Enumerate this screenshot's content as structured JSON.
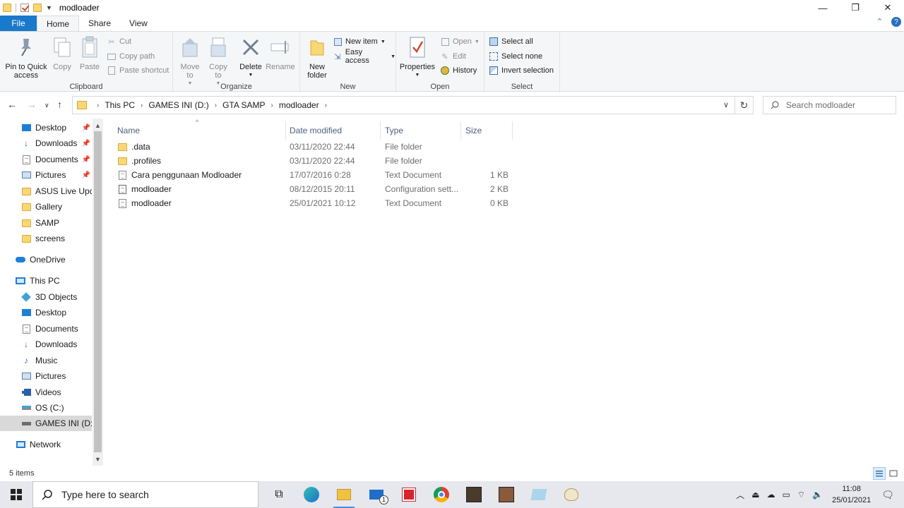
{
  "window": {
    "title": "modloader",
    "controls": {
      "minimize": "—",
      "maximize": "❐",
      "close": "✕"
    }
  },
  "ribbon_tabs": [
    "File",
    "Home",
    "Share",
    "View"
  ],
  "ribbon": {
    "clipboard": {
      "label": "Clipboard",
      "pin": "Pin to Quick access",
      "copy": "Copy",
      "paste": "Paste",
      "cut": "Cut",
      "copy_path": "Copy path",
      "paste_shortcut": "Paste shortcut"
    },
    "organize": {
      "label": "Organize",
      "move_to": "Move to",
      "copy_to": "Copy to",
      "delete": "Delete",
      "rename": "Rename"
    },
    "new": {
      "label": "New",
      "new_folder": "New folder",
      "new_item": "New item",
      "easy_access": "Easy access"
    },
    "open": {
      "label": "Open",
      "properties": "Properties",
      "open": "Open",
      "edit": "Edit",
      "history": "History"
    },
    "select": {
      "label": "Select",
      "select_all": "Select all",
      "select_none": "Select none",
      "invert": "Invert selection"
    }
  },
  "address": {
    "crumbs": [
      "This PC",
      "GAMES INI (D:)",
      "GTA SAMP",
      "modloader"
    ],
    "search_placeholder": "Search modloader"
  },
  "nav": {
    "quick_access": [
      {
        "label": "Desktop",
        "icon": "desktop-icon",
        "pinned": true
      },
      {
        "label": "Downloads",
        "icon": "downloads-icon",
        "pinned": true
      },
      {
        "label": "Documents",
        "icon": "documents-icon",
        "pinned": true
      },
      {
        "label": "Pictures",
        "icon": "pictures-icon",
        "pinned": true
      },
      {
        "label": "ASUS Live Updat",
        "icon": "folder-icon",
        "pinned": false
      },
      {
        "label": "Gallery",
        "icon": "folder-icon",
        "pinned": false
      },
      {
        "label": "SAMP",
        "icon": "folder-icon",
        "pinned": false
      },
      {
        "label": "screens",
        "icon": "folder-icon",
        "pinned": false
      }
    ],
    "onedrive": "OneDrive",
    "this_pc": "This PC",
    "this_pc_items": [
      {
        "label": "3D Objects",
        "icon": "3d-objects-icon"
      },
      {
        "label": "Desktop",
        "icon": "desktop-icon"
      },
      {
        "label": "Documents",
        "icon": "documents-icon"
      },
      {
        "label": "Downloads",
        "icon": "downloads-icon"
      },
      {
        "label": "Music",
        "icon": "music-icon"
      },
      {
        "label": "Pictures",
        "icon": "pictures-icon"
      },
      {
        "label": "Videos",
        "icon": "videos-icon"
      },
      {
        "label": "OS (C:)",
        "icon": "drive-icon"
      },
      {
        "label": "GAMES INI (D:)",
        "icon": "drive-icon",
        "selected": true
      }
    ],
    "network": "Network"
  },
  "file_list": {
    "columns": [
      "Name",
      "Date modified",
      "Type",
      "Size"
    ],
    "rows": [
      {
        "name": ".data",
        "date": "03/11/2020 22:44",
        "type": "File folder",
        "size": "",
        "icon": "folder-icon"
      },
      {
        "name": ".profiles",
        "date": "03/11/2020 22:44",
        "type": "File folder",
        "size": "",
        "icon": "folder-icon"
      },
      {
        "name": "Cara penggunaan Modloader",
        "date": "17/07/2016 0:28",
        "type": "Text Document",
        "size": "1 KB",
        "icon": "text-file-icon"
      },
      {
        "name": "modloader",
        "date": "08/12/2015 20:11",
        "type": "Configuration sett...",
        "size": "2 KB",
        "icon": "config-file-icon"
      },
      {
        "name": "modloader",
        "date": "25/01/2021 10:12",
        "type": "Text Document",
        "size": "0 KB",
        "icon": "text-file-icon"
      }
    ]
  },
  "status": {
    "item_count": "5 items"
  },
  "taskbar": {
    "search_placeholder": "Type here to search",
    "clock_time": "11:08",
    "clock_date": "25/01/2021",
    "mail_badge": "1"
  }
}
